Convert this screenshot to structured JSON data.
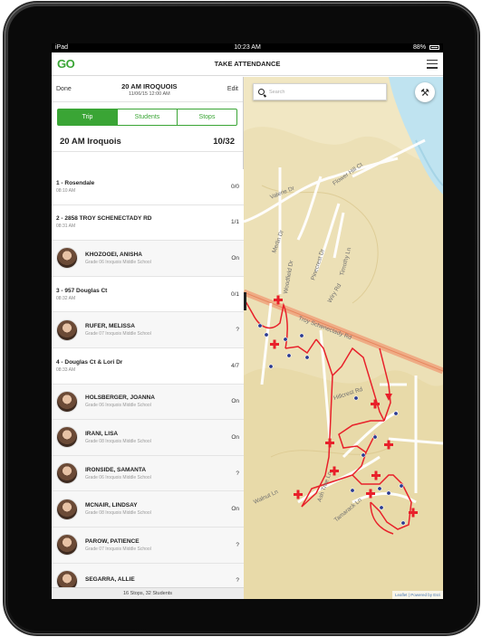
{
  "status": {
    "device": "iPad",
    "time": "10:23 AM",
    "battery": "88%"
  },
  "app": {
    "logo": "GO",
    "title": "TAKE ATTENDANCE"
  },
  "trip_header": {
    "done": "Done",
    "title": "20 AM IROQUOIS",
    "datetime": "11/06/15 12:00 AM",
    "edit": "Edit"
  },
  "tabs": [
    {
      "label": "Trip",
      "active": true
    },
    {
      "label": "Students",
      "active": false
    },
    {
      "label": "Stops",
      "active": false
    }
  ],
  "summary": {
    "name": "20 AM Iroquois",
    "count": "10/32"
  },
  "rows": [
    {
      "type": "stop",
      "title": "1 - Rosendale",
      "time": "08:10 AM",
      "value": "0/0"
    },
    {
      "type": "stop",
      "title": "2 - 2858 TROY SCHENECTADY RD",
      "time": "08:31 AM",
      "value": "1/1"
    },
    {
      "type": "student",
      "name": "KHOZOOEI, ANISHA",
      "grade": "Grade 06 Iroquois Middle School",
      "value": "On"
    },
    {
      "type": "stop",
      "title": "3 - 957 Douglas Ct",
      "time": "08:32 AM",
      "value": "0/1"
    },
    {
      "type": "student",
      "name": "RUFER, MELISSA",
      "grade": "Grade 07 Iroquois Middle School",
      "value": "?"
    },
    {
      "type": "stop",
      "title": "4 - Douglas Ct & Lori Dr",
      "time": "08:33 AM",
      "value": "4/7"
    },
    {
      "type": "student",
      "name": "HOLSBERGER, JOANNA",
      "grade": "Grade 06 Iroquois Middle School",
      "value": "On"
    },
    {
      "type": "student",
      "name": "IRANI, LISA",
      "grade": "Grade 08 Iroquois Middle School",
      "value": "On"
    },
    {
      "type": "student",
      "name": "IRONSIDE, SAMANTA",
      "grade": "Grade 06 Iroquois Middle School",
      "value": "?"
    },
    {
      "type": "student",
      "name": "MCNAIR, LINDSAY",
      "grade": "Grade 08 Iroquois Middle School",
      "value": "On"
    },
    {
      "type": "student",
      "name": "PAROW, PATIENCE",
      "grade": "Grade 07 Iroquois Middle School",
      "value": "?"
    },
    {
      "type": "student",
      "name": "SEGARRA, ALLIE",
      "grade": "",
      "value": "?"
    }
  ],
  "footer": "16 Stops, 32 Students",
  "map": {
    "search_placeholder": "Search",
    "attribution": "Leaflet | Powered by Esri",
    "streets": [
      {
        "label": "Valerie Dr"
      },
      {
        "label": "Flower Hill Ct"
      },
      {
        "label": "Merlin Dr"
      },
      {
        "label": "Woodfield Dr"
      },
      {
        "label": "Pinecrest Dr"
      },
      {
        "label": "Wiry Rd"
      },
      {
        "label": "Timothy Ln"
      },
      {
        "label": "Troy Schenectady Rd"
      },
      {
        "label": "Hillcrest Rd"
      },
      {
        "label": "Walnut Ln"
      },
      {
        "label": "Ash Tree Ln"
      },
      {
        "label": "Tamarack Ln"
      }
    ],
    "colors": {
      "route": "#e8202a",
      "stop": "#e8202a",
      "student_dot": "#2b3a8f",
      "terrain": "#f1e7c3",
      "water": "#bfe3f0",
      "road": "#ffffff",
      "highway": "#f0a07a"
    }
  }
}
